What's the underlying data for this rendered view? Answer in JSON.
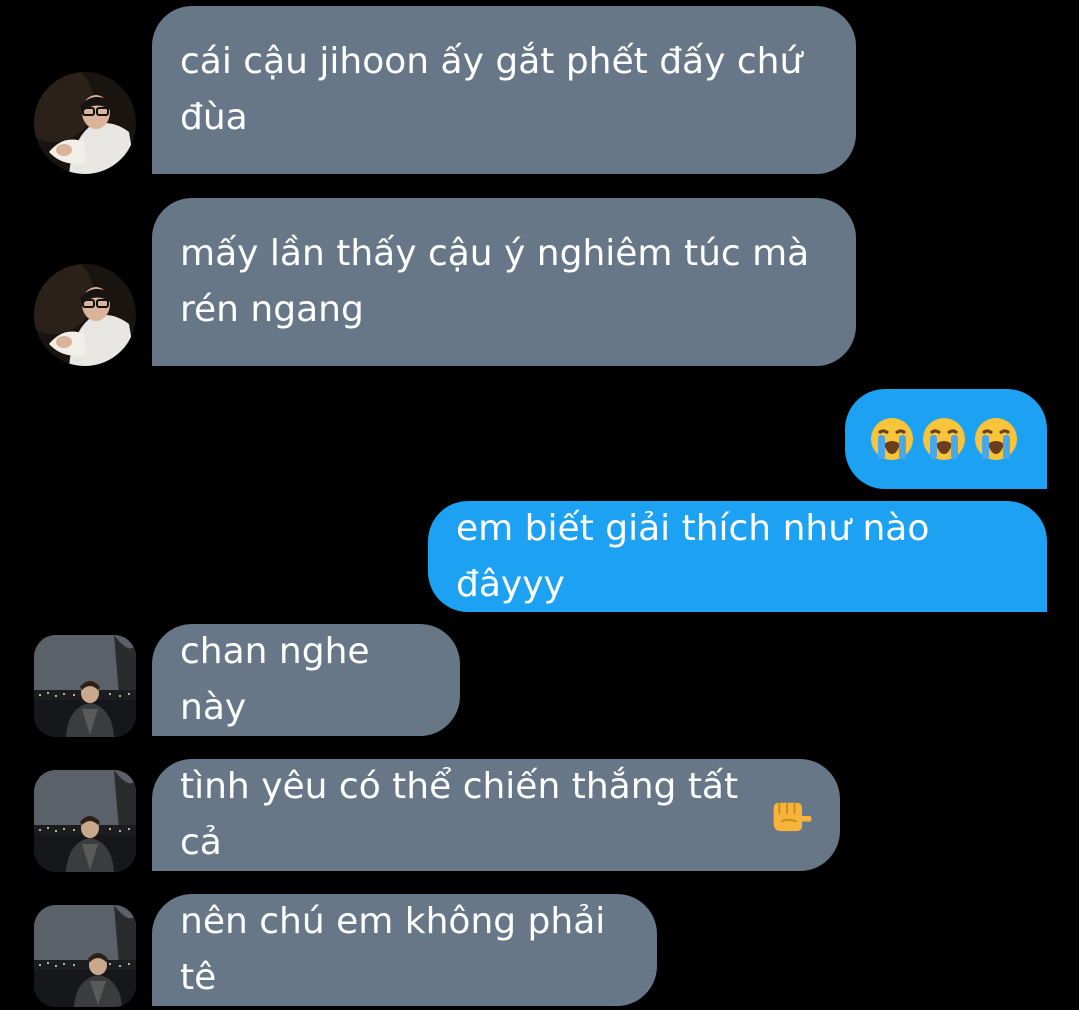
{
  "conversation": {
    "messages": [
      {
        "sender": "other",
        "avatar": "man-glasses-avatar",
        "text": "cái cậu jihoon ấy gắt phết đấy chứ đùa",
        "line1": "cái cậu jihoon ấy gắt phết đấy chứ",
        "line2": "đùa"
      },
      {
        "sender": "other",
        "avatar": "man-glasses-avatar",
        "text": "mấy lần thấy cậu ý nghiêm túc mà rén ngang",
        "line1": "mấy lần thấy cậu ý nghiêm túc mà",
        "line2": "rén ngang"
      },
      {
        "sender": "me",
        "text": "😭😭😭",
        "emoji": "loudly-crying-face"
      },
      {
        "sender": "me",
        "text": "em biết giải thích như nào đâyyy"
      },
      {
        "sender": "other",
        "avatar": "night-lake-avatar",
        "text": "chan nghe này"
      },
      {
        "sender": "other",
        "avatar": "night-lake-avatar",
        "text": "tình yêu có thể chiến thắng tất cả",
        "emoji": "fist-pointing-hand"
      },
      {
        "sender": "other",
        "avatar": "night-lake-avatar",
        "text": "nên chú em không phải tê"
      }
    ]
  },
  "colors": {
    "background": "#000000",
    "incoming_bubble": "#677788",
    "outgoing_bubble": "#1da1f2",
    "text": "#ffffff"
  }
}
